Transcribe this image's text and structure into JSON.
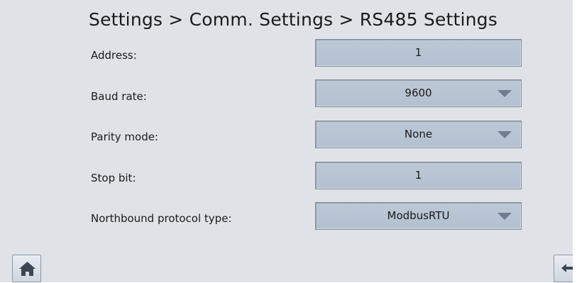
{
  "header": {
    "breadcrumb": "Settings > Comm. Settings > RS485 Settings"
  },
  "settings": [
    {
      "label": "Address:",
      "value": "1",
      "type": "input"
    },
    {
      "label": "Baud rate:",
      "value": "9600",
      "type": "dropdown"
    },
    {
      "label": "Parity mode:",
      "value": "None",
      "type": "dropdown"
    },
    {
      "label": "Stop bit:",
      "value": "1",
      "type": "input"
    },
    {
      "label": "Northbound protocol type:",
      "value": "ModbusRTU",
      "type": "dropdown"
    }
  ],
  "footer": {
    "home_icon": "home-icon",
    "back_icon": "back-arrow-icon"
  },
  "colors": {
    "background": "#dfe3e8",
    "field_fill": "#b8c4d2",
    "caret": "#6f7d8e"
  }
}
